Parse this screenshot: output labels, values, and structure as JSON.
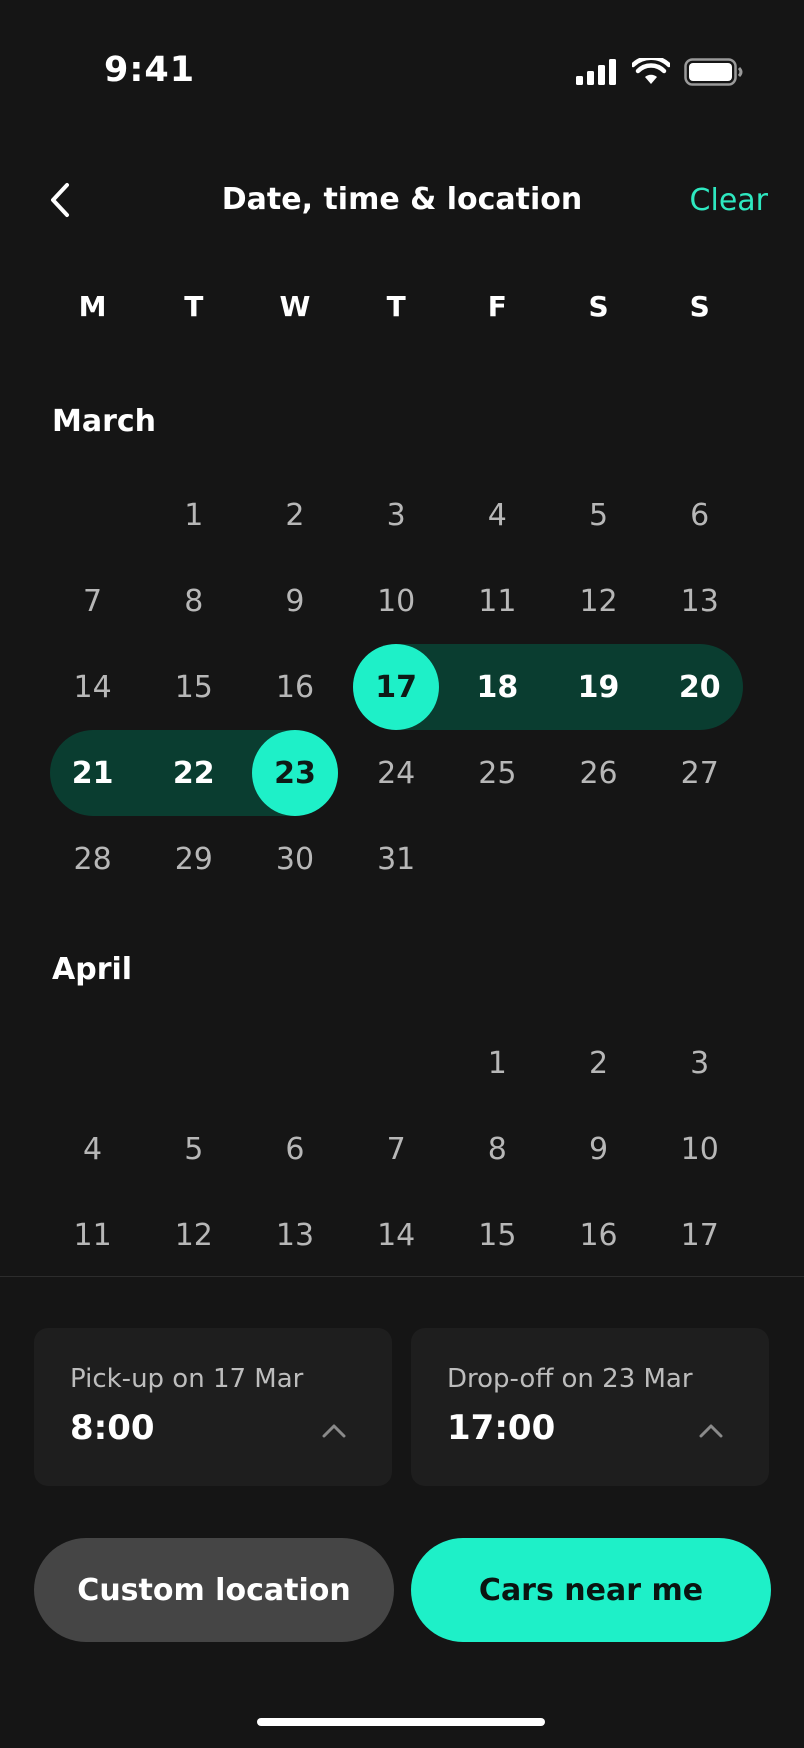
{
  "status_bar": {
    "time": "9:41"
  },
  "nav": {
    "title": "Date, time & location",
    "clear_label": "Clear"
  },
  "weekdays": [
    "M",
    "T",
    "W",
    "T",
    "F",
    "S",
    "S"
  ],
  "months": [
    {
      "name": "March",
      "rows": [
        [
          "",
          "1",
          "2",
          "3",
          "4",
          "5",
          "6"
        ],
        [
          "7",
          "8",
          "9",
          "10",
          "11",
          "12",
          "13"
        ],
        [
          "14",
          "15",
          "16",
          "17",
          "18",
          "19",
          "20"
        ],
        [
          "21",
          "22",
          "23",
          "24",
          "25",
          "26",
          "27"
        ],
        [
          "28",
          "29",
          "30",
          "31",
          "",
          "",
          ""
        ]
      ]
    },
    {
      "name": "April",
      "rows": [
        [
          "",
          "",
          "",
          "",
          "1",
          "2",
          "3"
        ],
        [
          "4",
          "5",
          "6",
          "7",
          "8",
          "9",
          "10"
        ],
        [
          "11",
          "12",
          "13",
          "14",
          "15",
          "16",
          "17"
        ]
      ]
    }
  ],
  "selection": {
    "start": "17",
    "end": "23",
    "month": "March"
  },
  "pickup": {
    "label": "Pick-up on 17 Mar",
    "time": "8:00"
  },
  "dropoff": {
    "label": "Drop-off on 23 Mar",
    "time": "17:00"
  },
  "buttons": {
    "custom_location": "Custom location",
    "cars_near_me": "Cars near me"
  },
  "colors": {
    "accent": "#1ef0c8",
    "range": "#0a3d30",
    "background": "#151515",
    "card": "#1e1e1e"
  }
}
